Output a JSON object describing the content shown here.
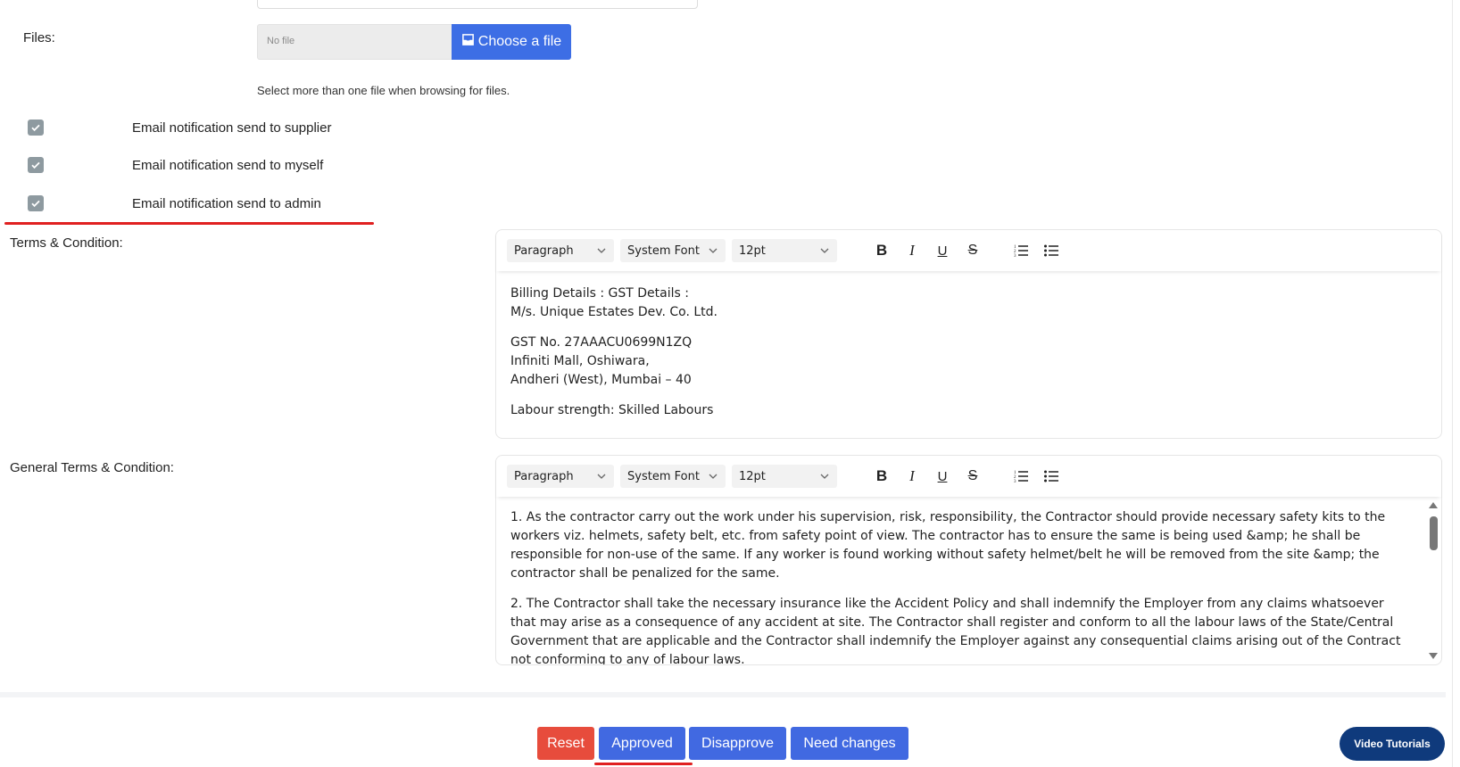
{
  "files": {
    "label": "Files:",
    "placeholder": "No file",
    "choose_label": "Choose a file",
    "hint": "Select more than one file when browsing for files."
  },
  "notifications": [
    {
      "label": "Email notification send to supplier",
      "checked": true
    },
    {
      "label": "Email notification send to myself",
      "checked": true
    },
    {
      "label": "Email notification send to admin",
      "checked": true
    }
  ],
  "terms": {
    "label": "Terms & Condition:",
    "toolbar": {
      "format": "Paragraph",
      "font": "System Font",
      "size": "12pt"
    },
    "paragraphs": [
      "Billing Details : GST Details :\nM/s. Unique Estates Dev. Co. Ltd.",
      "GST No. 27AAACU0699N1ZQ\nInfiniti Mall, Oshiwara,\nAndheri (West), Mumbai – 40",
      "Labour strength: Skilled Labours"
    ]
  },
  "general_terms": {
    "label": "General Terms & Condition:",
    "toolbar": {
      "format": "Paragraph",
      "font": "System Font",
      "size": "12pt"
    },
    "paragraphs": [
      "1. As the contractor carry out the work under his supervision, risk, responsibility, the Contractor should provide necessary safety kits to the workers viz. helmets, safety belt, etc. from safety point of view. The contractor has to ensure the same is being used &amp; he shall be responsible for non-use of the same. If any worker is found working without safety helmet/belt he will be removed from the site &amp; the contractor shall be penalized for the same.",
      "2. The Contractor shall take the necessary insurance like the Accident Policy and shall indemnify the Employer from any claims whatsoever that may arise as a consequence of any accident at site. The Contractor shall register and conform to all the labour laws of the State/Central Government that are applicable and the Contractor shall indemnify the Employer against any consequential claims arising out of the Contract not conforming to any of labour laws."
    ]
  },
  "actions": {
    "reset": "Reset",
    "approved": "Approved",
    "disapprove": "Disapprove",
    "need_changes": "Need changes"
  },
  "video_tutorials": "Video Tutorials",
  "colors": {
    "primary": "#4169e1",
    "danger": "#e74c3c",
    "file_button": "#3d6ee5",
    "video_button": "#0f3a7c",
    "highlight_underline": "#e02020",
    "checkbox": "#8e9aa0"
  }
}
